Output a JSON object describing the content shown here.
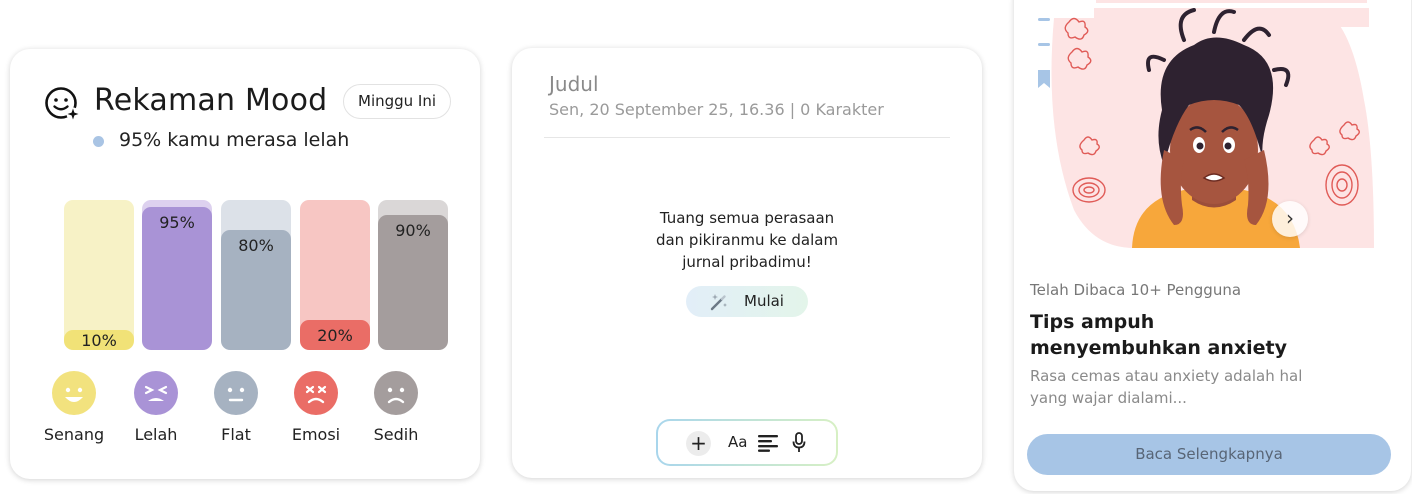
{
  "mood": {
    "title": "Rekaman Mood",
    "period": "Minggu Ini",
    "summary": "95% kamu merasa lelah",
    "moods": [
      {
        "name": "Senang",
        "percent": 10,
        "label": "10%",
        "track": "#f7f2c6",
        "fill": "#f1e277",
        "face": "#f2e27e",
        "icon": "happy-face-icon"
      },
      {
        "name": "Lelah",
        "percent": 95,
        "label": "95%",
        "track": "#ddd1ef",
        "fill": "#a993d6",
        "face": "#a993d6",
        "icon": "tired-face-icon"
      },
      {
        "name": "Flat",
        "percent": 80,
        "label": "80%",
        "track": "#dce1e8",
        "fill": "#a6b2c1",
        "face": "#a6b2c1",
        "icon": "neutral-face-icon"
      },
      {
        "name": "Emosi",
        "percent": 20,
        "label": "20%",
        "track": "#f7c6c3",
        "fill": "#ea6d66",
        "face": "#ea6d66",
        "icon": "angry-face-icon"
      },
      {
        "name": "Sedih",
        "percent": 90,
        "label": "90%",
        "track": "#dad7d7",
        "fill": "#a49d9d",
        "face": "#a49d9d",
        "icon": "sad-face-icon"
      }
    ]
  },
  "journal": {
    "title": "Judul",
    "meta": "Sen, 20 September 25, 16.36 | 0 Karakter",
    "prompt_lines": [
      "Tuang semua perasaan",
      "dan pikiranmu ke dalam",
      "jurnal pribadimu!"
    ],
    "start_label": "Mulai",
    "toolbar": {
      "plus": "+",
      "text_format": "Aa"
    }
  },
  "article": {
    "read_count": "Telah Dibaca 10+ Pengguna",
    "title": "Tips ampuh menyembuhkan anxiety",
    "description": "Rasa cemas atau anxiety adalah hal yang wajar dialami...",
    "button": "Baca Selengkapnya",
    "next": "›"
  },
  "colors": {
    "accent_blue": "#a7c5e6",
    "illustration_bg": "#fde2e2",
    "summary_dot": "#a9c4e4"
  }
}
